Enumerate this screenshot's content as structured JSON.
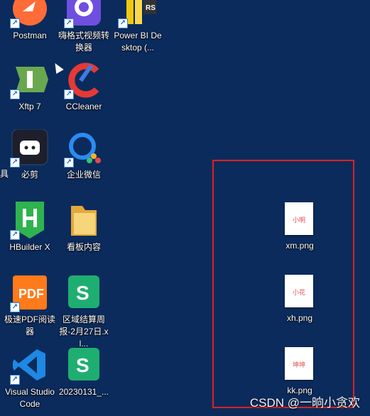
{
  "icons": {
    "postman": {
      "label": "Postman",
      "color": "#ff6c37"
    },
    "heige": {
      "label": "嗨格式视频转换器",
      "color": "#6f4ee0"
    },
    "powerbi": {
      "label": "Power BI Desktop (...",
      "color": "#f2c811"
    },
    "xftp": {
      "label": "Xftp 7",
      "color": "#6aa84f"
    },
    "ccleaner": {
      "label": "CCleaner",
      "color": "#e53935"
    },
    "bijian": {
      "label": "必剪",
      "color": "#1d1f2a"
    },
    "wecom": {
      "label": "企业微信",
      "color": "#2b8bf2"
    },
    "hbuilder": {
      "label": "HBuilder X",
      "color": "#2fb34f"
    },
    "kanban": {
      "label": "看板内容",
      "color": "#f2c14a"
    },
    "pdfreader": {
      "label": "极速PDF阅读器",
      "color": "#ff7a1a"
    },
    "quyu": {
      "label": "区域结算周报-2月27日.xl...",
      "color": "#1fae72"
    },
    "vscode": {
      "label": "Visual Studio Code",
      "color": "#1e88e5"
    },
    "wps20230131": {
      "label": "20230131_...",
      "color": "#1fae72"
    }
  },
  "files": [
    {
      "name": "xm.png",
      "thumb_text": "小明"
    },
    {
      "name": "xh.png",
      "thumb_text": "小花"
    },
    {
      "name": "kk.png",
      "thumb_text": "坤坤"
    }
  ],
  "edge_label": "具",
  "watermark": "CSDN @一晌小贪欢"
}
